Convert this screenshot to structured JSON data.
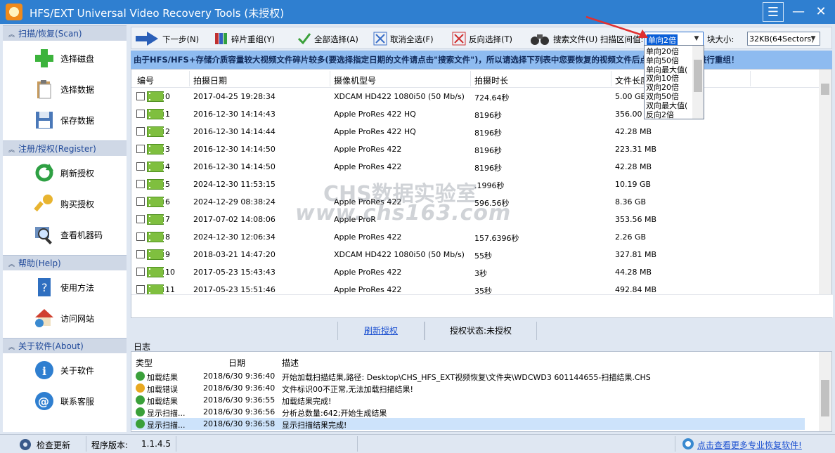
{
  "window": {
    "title": "HFS/EXT Universal Video Recovery Tools  (未授权)"
  },
  "sidebar": {
    "sections": [
      {
        "title": "扫描/恢复(Scan)",
        "items": [
          "选择磁盘",
          "选择数据",
          "保存数据"
        ]
      },
      {
        "title": "注册/授权(Register)",
        "items": [
          "刷新授权",
          "购买授权",
          "查看机器码"
        ]
      },
      {
        "title": "帮助(Help)",
        "items": [
          "使用方法",
          "访问网站"
        ]
      },
      {
        "title": "关于软件(About)",
        "items": [
          "关于软件",
          "联系客服"
        ]
      }
    ]
  },
  "toolbar": {
    "next": "下一步(N)",
    "reassemble": "碎片重组(Y)",
    "select_all": "全部选择(A)",
    "deselect_all": "取消全选(F)",
    "invert": "反向选择(T)",
    "search_files": "搜索文件(U)",
    "scan_range_label": "扫描区间值:",
    "scan_range_value": "单向2倍",
    "block_size_label": "块大小:",
    "block_size_value": "32KB(64Sectors)"
  },
  "dropdown": {
    "options": [
      "单向20倍",
      "单向50倍",
      "单向最大值(",
      "双向10倍",
      "双向20倍",
      "双向50倍",
      "双向最大值(",
      "反向2倍"
    ]
  },
  "notice": "由于HFS/HFS+存储介质容量较大视频文件碎片较多(要选择指定日期的文件请点击\"搜索文件\")，所以请选择下列表中您要恢复的视频文件后点击[ 碎片重组]进行重组！",
  "table": {
    "columns": [
      "编号",
      "拍摄日期",
      "摄像机型号",
      "拍摄时长",
      "文件长度"
    ],
    "rows": [
      {
        "id": "0",
        "date": "2017-04-25 19:28:34",
        "model": "XDCAM HD422 1080i50 (50 Mb/s)",
        "duration": "724.64秒",
        "size": "5.00 GB"
      },
      {
        "id": "1",
        "date": "2016-12-30 14:14:43",
        "model": "Apple ProRes 422 HQ",
        "duration": "8196秒",
        "size": "356.00 MB"
      },
      {
        "id": "2",
        "date": "2016-12-30 14:14:44",
        "model": "Apple ProRes 422 HQ",
        "duration": "8196秒",
        "size": "42.28 MB"
      },
      {
        "id": "3",
        "date": "2016-12-30 14:14:50",
        "model": "Apple ProRes 422",
        "duration": "8196秒",
        "size": "223.31 MB"
      },
      {
        "id": "4",
        "date": "2016-12-30 14:14:50",
        "model": "Apple ProRes 422",
        "duration": "8196秒",
        "size": "42.28 MB"
      },
      {
        "id": "5",
        "date": "2024-12-30 11:53:15",
        "model": "",
        "duration": ".1996秒",
        "size": "10.19 GB"
      },
      {
        "id": "6",
        "date": "2024-12-29 08:38:24",
        "model": "Apple ProRes 422",
        "duration": "596.56秒",
        "size": "8.36 GB"
      },
      {
        "id": "7",
        "date": "2017-07-02 14:08:06",
        "model": "Apple ProR",
        "duration": "",
        "size": "353.56 MB"
      },
      {
        "id": "8",
        "date": "2024-12-30 12:06:34",
        "model": "Apple ProRes 422",
        "duration": "157.6396秒",
        "size": "2.26 GB"
      },
      {
        "id": "9",
        "date": "2018-03-21 14:47:20",
        "model": "XDCAM HD422 1080i50 (50 Mb/s)",
        "duration": "55秒",
        "size": "327.81 MB"
      },
      {
        "id": "10",
        "date": "2017-05-23 15:43:43",
        "model": "Apple ProRes 422",
        "duration": "3秒",
        "size": "44.28 MB"
      },
      {
        "id": "11",
        "date": "2017-05-23 15:51:46",
        "model": "Apple ProRes 422",
        "duration": "35秒",
        "size": "492.84 MB"
      }
    ]
  },
  "watermark": {
    "line1": "CHS数据实验室",
    "line2": "www.chs163.com"
  },
  "midbar": {
    "refresh": "刷新授权",
    "status": "授权状态:未授权"
  },
  "log": {
    "title": "日志",
    "columns": [
      "类型",
      "日期",
      "描述"
    ],
    "rows": [
      {
        "type": "加载结果",
        "level": "info",
        "date": "2018/6/30 9:36:40",
        "desc": "开始加载扫描结果,路径:        Desktop\\CHS_HFS_EXT视频恢复\\文件夹\\WDCWD3          601144655-扫描结果.CHS"
      },
      {
        "type": "加载错误",
        "level": "warn",
        "date": "2018/6/30 9:36:40",
        "desc": "文件标识00不正常,无法加载扫描结果!"
      },
      {
        "type": "加载结果",
        "level": "info",
        "date": "2018/6/30 9:36:55",
        "desc": "加载结果完成!"
      },
      {
        "type": "显示扫描...",
        "level": "info",
        "date": "2018/6/30 9:36:56",
        "desc": "分析总数量:642;开始生成结果"
      },
      {
        "type": "显示扫描...",
        "level": "info",
        "date": "2018/6/30 9:36:58",
        "desc": "显示扫描结果完成!"
      }
    ]
  },
  "statusbar": {
    "check_update": "检查更新",
    "version_label": "程序版本:",
    "version": "1.1.4.5",
    "more_link": "点击查看更多专业恢复软件!"
  },
  "colors": {
    "titlebar": "#2f7fd0",
    "notice": "#8ebbf0",
    "link": "#1a4fd0",
    "accent_red_arrow": "#e03030"
  }
}
